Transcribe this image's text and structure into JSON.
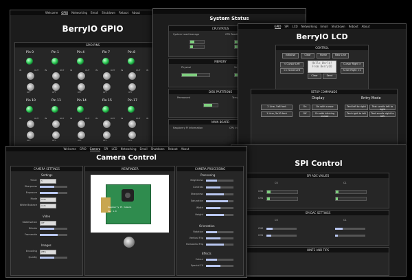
{
  "gpio": {
    "nav": [
      "Welcome",
      "GPIO",
      "Networking",
      "Email",
      "Shutdown",
      "Reboot",
      "About"
    ],
    "title": "BerryIO GPIO",
    "panel": "GPIO PINS",
    "pins": [
      "Pin 0",
      "Pin 1",
      "Pin 4",
      "Pin 7",
      "Pin 8",
      "Pin 9",
      "Pin 10",
      "Pin 11",
      "Pin 14",
      "Pin 15",
      "Pin 17",
      "Pin 18",
      "Pin 21",
      "Pin 22",
      "Pin 23",
      "Pin 24",
      "Pin 25"
    ],
    "pin_states": [
      "on",
      "on",
      "on",
      "on",
      "on",
      "off",
      "on",
      "on",
      "on",
      "on",
      "on",
      "on",
      "on",
      "on",
      "on",
      "on",
      "on"
    ],
    "in_label": "IN",
    "out_label": "OUT",
    "off_label": "OFF"
  },
  "status": {
    "title": "System Status",
    "sections": {
      "cpu": "CPU STATUS",
      "memory": "MEMORY",
      "disk": "DISK PARTITIONS",
      "main": "MAIN BOARD"
    },
    "sub": {
      "load": "System Load Average",
      "cpu": "CPU Readings",
      "physical": "Physical",
      "virtual": "Virtual",
      "permanent": "Permanent",
      "temporary": "Temporary",
      "rpi_info": "Raspberry Pi Information",
      "cpu_info": "CPU Information"
    }
  },
  "lcd": {
    "nav": [
      "GPIO",
      "SPI",
      "LCD",
      "Networking",
      "Email",
      "Shutdown",
      "Reboot",
      "About"
    ],
    "title": "BerryIO LCD",
    "control": "CONTROL",
    "top_buttons": [
      "Initialise",
      "Clear",
      "Home",
      "New Line"
    ],
    "display_text": [
      "Hello World!",
      "From BerryIO"
    ],
    "left_buttons": [
      "< Cursor Left",
      "<< Scroll Left"
    ],
    "right_buttons": [
      "Cursor Right >",
      "Scroll Right >>"
    ],
    "bottom_buttons": [
      "Clear",
      "Send"
    ],
    "setup": "SETUP COMMANDS",
    "setup_cols": [
      "Display",
      "Entry Mode"
    ],
    "setup_buttons": [
      "2 Line, 5x8 font",
      "1 Line, 5x10 font",
      "On",
      "Off",
      "On with cursor",
      "On with blinking cursor",
      "Text left to right",
      "Text scrolls left to right",
      "Text right to left",
      "Text scrolls right to left"
    ],
    "config": "CONFIGURATION / WIRING"
  },
  "camera": {
    "nav": [
      "Welcome",
      "GPIO",
      "Camera",
      "SPI",
      "LCD",
      "Networking",
      "Email",
      "Shutdown",
      "Reboot",
      "About"
    ],
    "title": "Camera Control",
    "settings": "CAMERA SETTINGS",
    "viewfinder": "VIEWFINDER",
    "processing": "CAMERA PROCESSING",
    "settings_group": "Settings",
    "settings_rows": [
      "Timer",
      "Sharpness",
      "Exposure",
      "Mode",
      "White Balance"
    ],
    "settings_values": [
      "5",
      "",
      "",
      "Auto",
      "Auto"
    ],
    "video_group": "Video",
    "video_rows": [
      "Stabilisation",
      "Bitrate",
      "Framerate"
    ],
    "video_values": [
      "Off",
      "",
      ""
    ],
    "images_group": "Images",
    "images_rows": [
      "Encoding",
      "Quality"
    ],
    "images_values": [
      "JPEG",
      ""
    ],
    "proc_group": "Processing",
    "proc_rows": [
      "Brightness",
      "Contrast",
      "Sharpness",
      "Saturation",
      "Width",
      "Height"
    ],
    "orient_group": "Orientation",
    "orient_rows": [
      "Rotation",
      "Vertical Flip",
      "Horizontal Flip"
    ],
    "effects_group": "Effects",
    "effects_rows": [
      "Colour",
      "Special FX"
    ],
    "board_text": [
      "Raspberry Pi Camera",
      "Rev 1.0"
    ]
  },
  "spi": {
    "title": "SPI Control",
    "adc": "SPI ADC VALUES",
    "c0": "C0",
    "c1": "C1",
    "ch0": "CH0",
    "ch1": "CH1",
    "dac": "SPI DAC SETTINGS",
    "hints": "HINTS AND TIPS"
  },
  "colors": {
    "led_on": "#2ecc55",
    "slider": "#b9c7f0",
    "header": "#111111",
    "accent": "#7fd17f"
  }
}
